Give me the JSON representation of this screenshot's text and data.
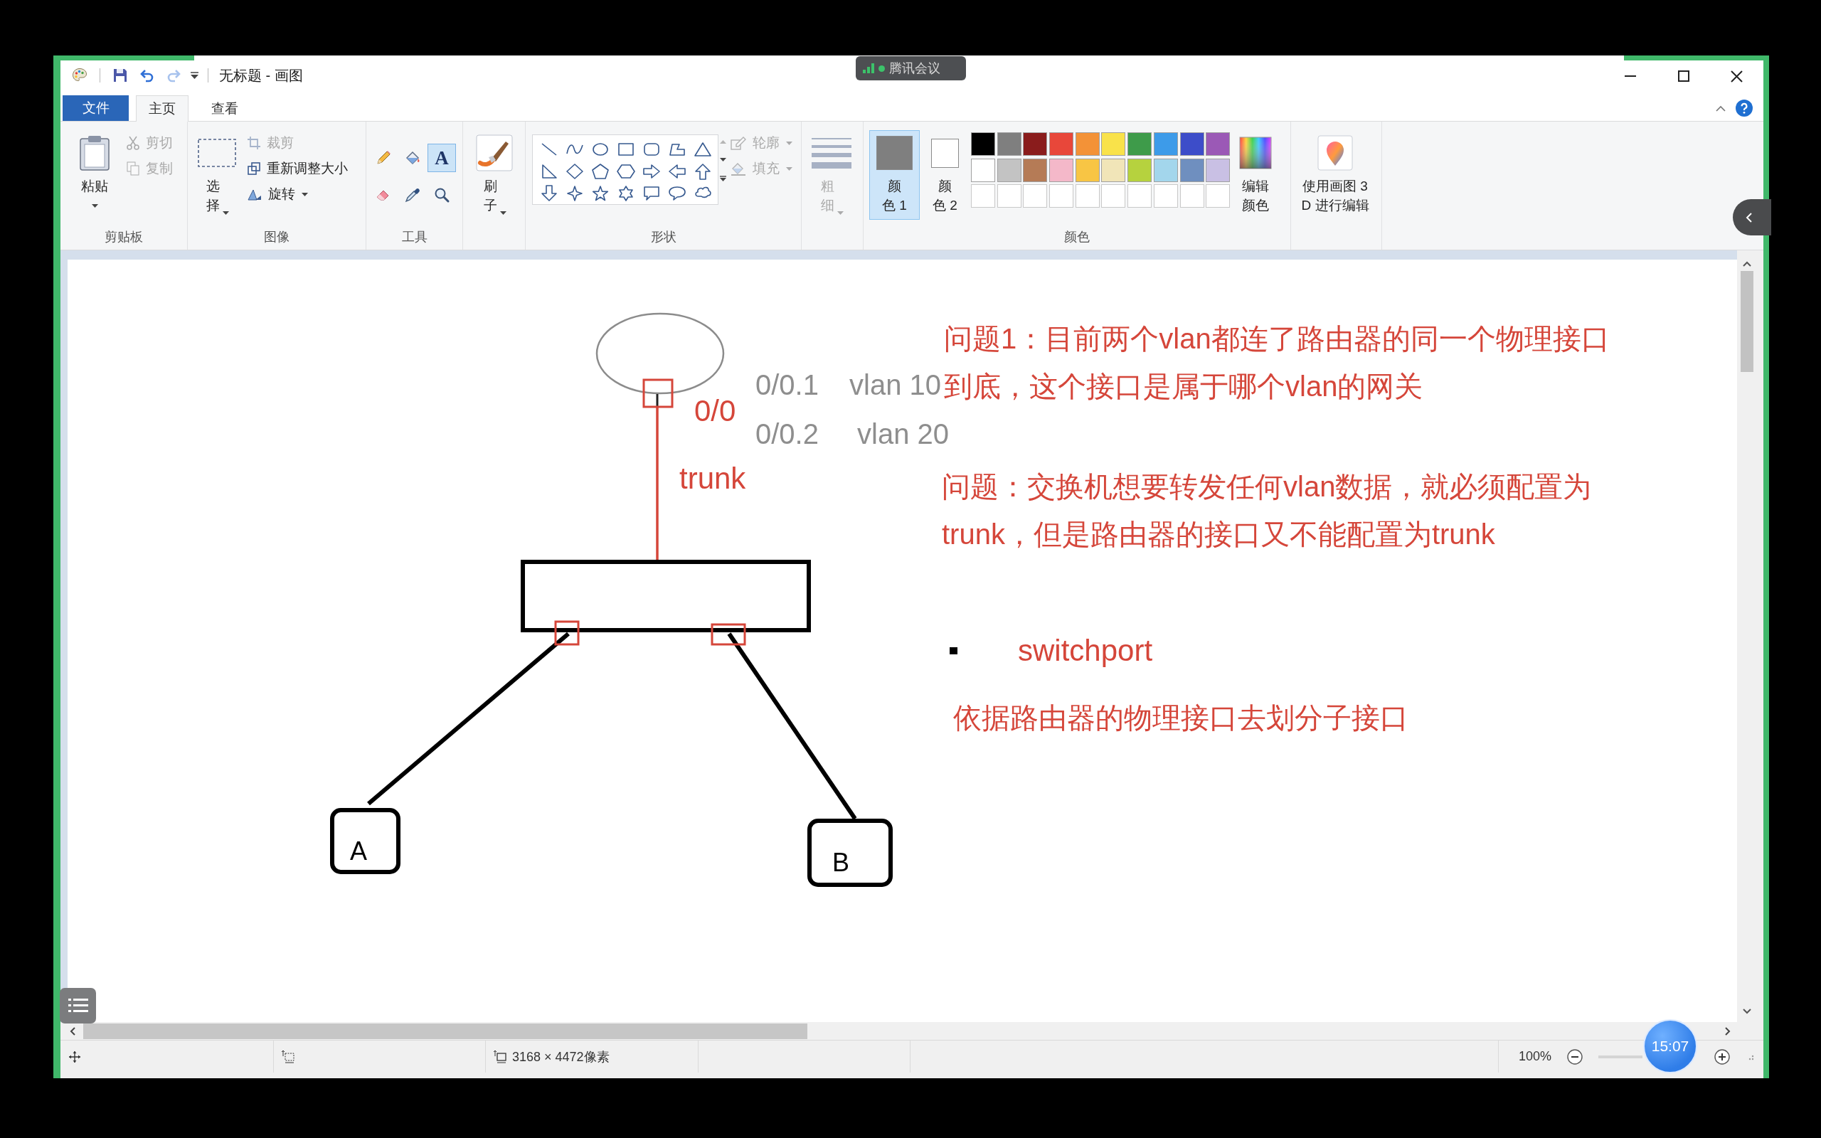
{
  "window": {
    "title": "无标题 - 画图",
    "quick_access": {
      "undo": {
        "disabled": false
      },
      "redo": {
        "disabled": true
      }
    }
  },
  "meeting_badge": {
    "label": "腾讯会议"
  },
  "ribbon_tabs": [
    {
      "kind": "menu",
      "label": "文件",
      "selected": false
    },
    {
      "kind": "tab",
      "label": "主页",
      "selected": true
    },
    {
      "kind": "tab",
      "label": "查看",
      "selected": false
    }
  ],
  "ribbon": {
    "clipboard": {
      "label": "剪贴板",
      "paste": {
        "label": "粘贴"
      },
      "cut": {
        "label": "剪切",
        "disabled": true
      },
      "copy": {
        "label": "复制",
        "disabled": true
      }
    },
    "image": {
      "label": "图像",
      "select": {
        "label": "选择"
      },
      "crop": {
        "label": "裁剪",
        "disabled": true
      },
      "resize": {
        "label": "重新调整大小",
        "disabled": false
      },
      "rotate": {
        "label": "旋转",
        "disabled": false
      }
    },
    "tools": {
      "label": "工具",
      "items": [
        {
          "kind": "pencil",
          "selected": false
        },
        {
          "kind": "fill",
          "selected": false
        },
        {
          "kind": "text",
          "label": "A",
          "selected": true
        },
        {
          "kind": "eraser",
          "selected": false
        },
        {
          "kind": "picker",
          "selected": false
        },
        {
          "kind": "magnifier",
          "selected": false
        }
      ]
    },
    "brushes": {
      "label": "刷子"
    },
    "shapes": {
      "label": "形状",
      "outline": {
        "label": "轮廓",
        "disabled": true
      },
      "fill": {
        "label": "填充",
        "disabled": true
      }
    },
    "size": {
      "label": "粗细",
      "disabled": true
    },
    "colors": {
      "label": "颜色",
      "color1": {
        "label": "颜色 1",
        "color": "#7f7f7f",
        "selected": true
      },
      "color2": {
        "label": "颜色 2",
        "color": "#ffffff",
        "selected": false
      },
      "palette": [
        {
          "color": "#000000"
        },
        {
          "color": "#7f7f7f"
        },
        {
          "color": "#8a1c1c"
        },
        {
          "color": "#e8473a"
        },
        {
          "color": "#f39237"
        },
        {
          "color": "#f9e24a"
        },
        {
          "color": "#3e9b4a"
        },
        {
          "color": "#3d9be9"
        },
        {
          "color": "#3d4dc9"
        },
        {
          "color": "#9b59b6"
        },
        {
          "color": "#ffffff"
        },
        {
          "color": "#c3c3c3"
        },
        {
          "color": "#b57b56"
        },
        {
          "color": "#f4b8c9"
        },
        {
          "color": "#f8c544"
        },
        {
          "color": "#f1e5b8"
        },
        {
          "color": "#b6d23e"
        },
        {
          "color": "#a3d6ec"
        },
        {
          "color": "#6f8fbf"
        },
        {
          "color": "#c9c0e4"
        }
      ],
      "edit": {
        "label": "编辑颜色"
      }
    },
    "paint3d": {
      "label": "使用画图 3\nD 进行编辑"
    }
  },
  "canvas": {
    "router": {
      "port_label": "0/0",
      "subinterfaces": [
        {
          "port": "0/0.1",
          "vlan": "vlan 10"
        },
        {
          "port": "0/0.2",
          "vlan": "vlan 20"
        }
      ]
    },
    "link_label": "trunk",
    "hosts": [
      {
        "label": "A"
      },
      {
        "label": "B"
      }
    ],
    "notes": [
      {
        "text": "问题1：目前两个vlan都连了路由器的同一个物理接口到底，这个接口是属于哪个vlan的网关"
      },
      {
        "text": "问题：交换机想要转发任何vlan数据，就必须配置为trunk，但是路由器的接口又不能配置为trunk"
      }
    ],
    "bullet_item": "switchport",
    "sub_note": "依据路由器的物理接口去划分子接口"
  },
  "status_bar": {
    "image_size": "3168 × 4472像素",
    "zoom": "100%"
  },
  "meeting_timer": "15:07"
}
